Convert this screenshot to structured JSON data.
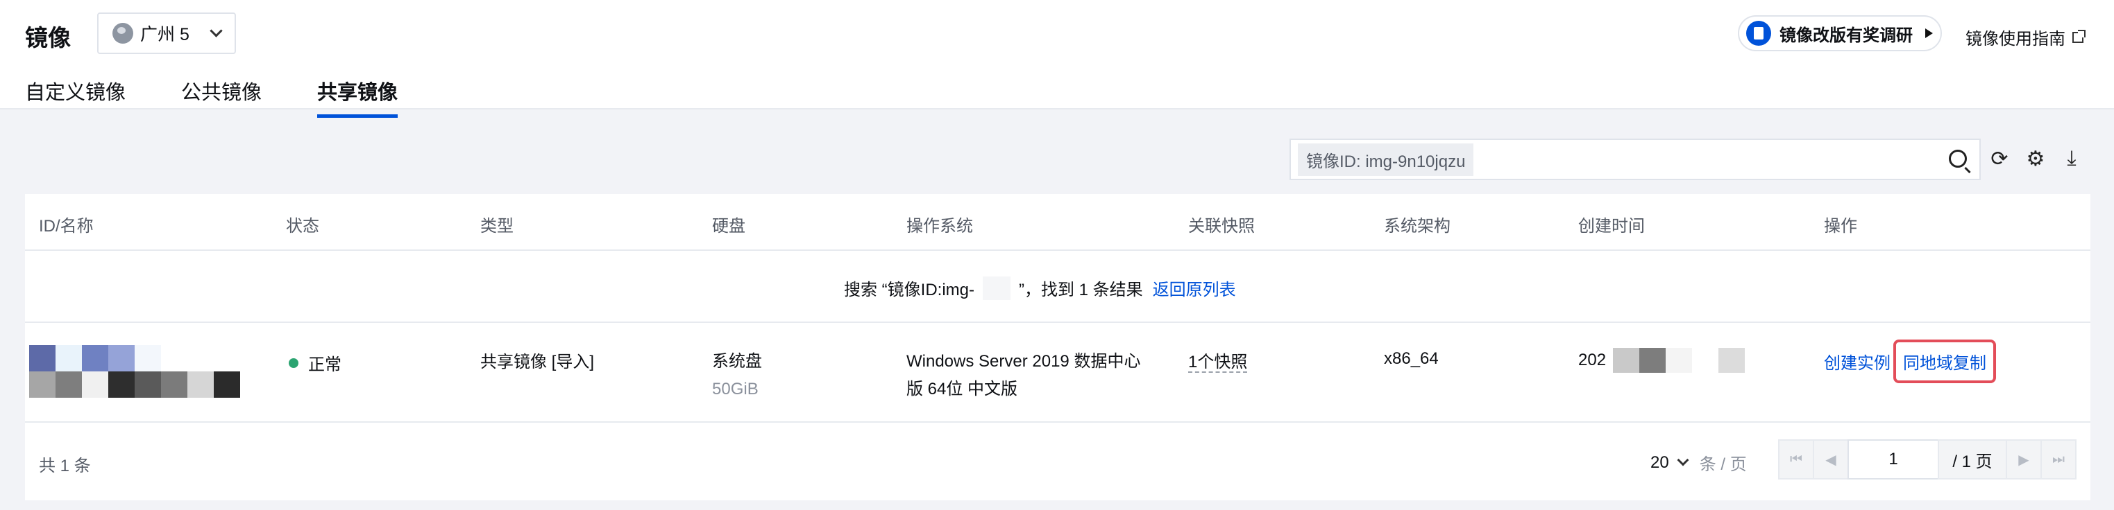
{
  "header": {
    "title": "镜像",
    "region": "广州 5",
    "survey_label": "镜像改版有奖调研",
    "guide_label": "镜像使用指南"
  },
  "tabs": [
    {
      "label": "自定义镜像",
      "active": false
    },
    {
      "label": "公共镜像",
      "active": false
    },
    {
      "label": "共享镜像",
      "active": true
    }
  ],
  "search": {
    "tag": "镜像ID: img-9n10jqzu"
  },
  "table": {
    "columns": [
      "ID/名称",
      "状态",
      "类型",
      "硬盘",
      "操作系统",
      "关联快照",
      "系统架构",
      "创建时间",
      "操作"
    ],
    "notice": {
      "prefix": "搜索 “镜像ID:img-",
      "suffix": "”，找到 1 条结果",
      "link": "返回原列表"
    },
    "rows": [
      {
        "status": "正常",
        "type": "共享镜像 [导入]",
        "disk": "系统盘",
        "disk_size": "50GiB",
        "os_line1": "Windows Server 2019 数据中心",
        "os_line2": "版 64位 中文版",
        "snapshots": "1个快照",
        "arch": "x86_64",
        "created_prefix": "202",
        "actions": {
          "create": "创建实例",
          "copy": "同地域复制"
        }
      }
    ]
  },
  "footer": {
    "total": "共 1 条",
    "page_size": "20",
    "page_size_unit": "条 / 页",
    "current_page": "1",
    "total_pages": "/ 1 页"
  },
  "colors": {
    "accent": "#0052d9",
    "status_ok": "#2ba471",
    "highlight_border": "#e34d59"
  }
}
